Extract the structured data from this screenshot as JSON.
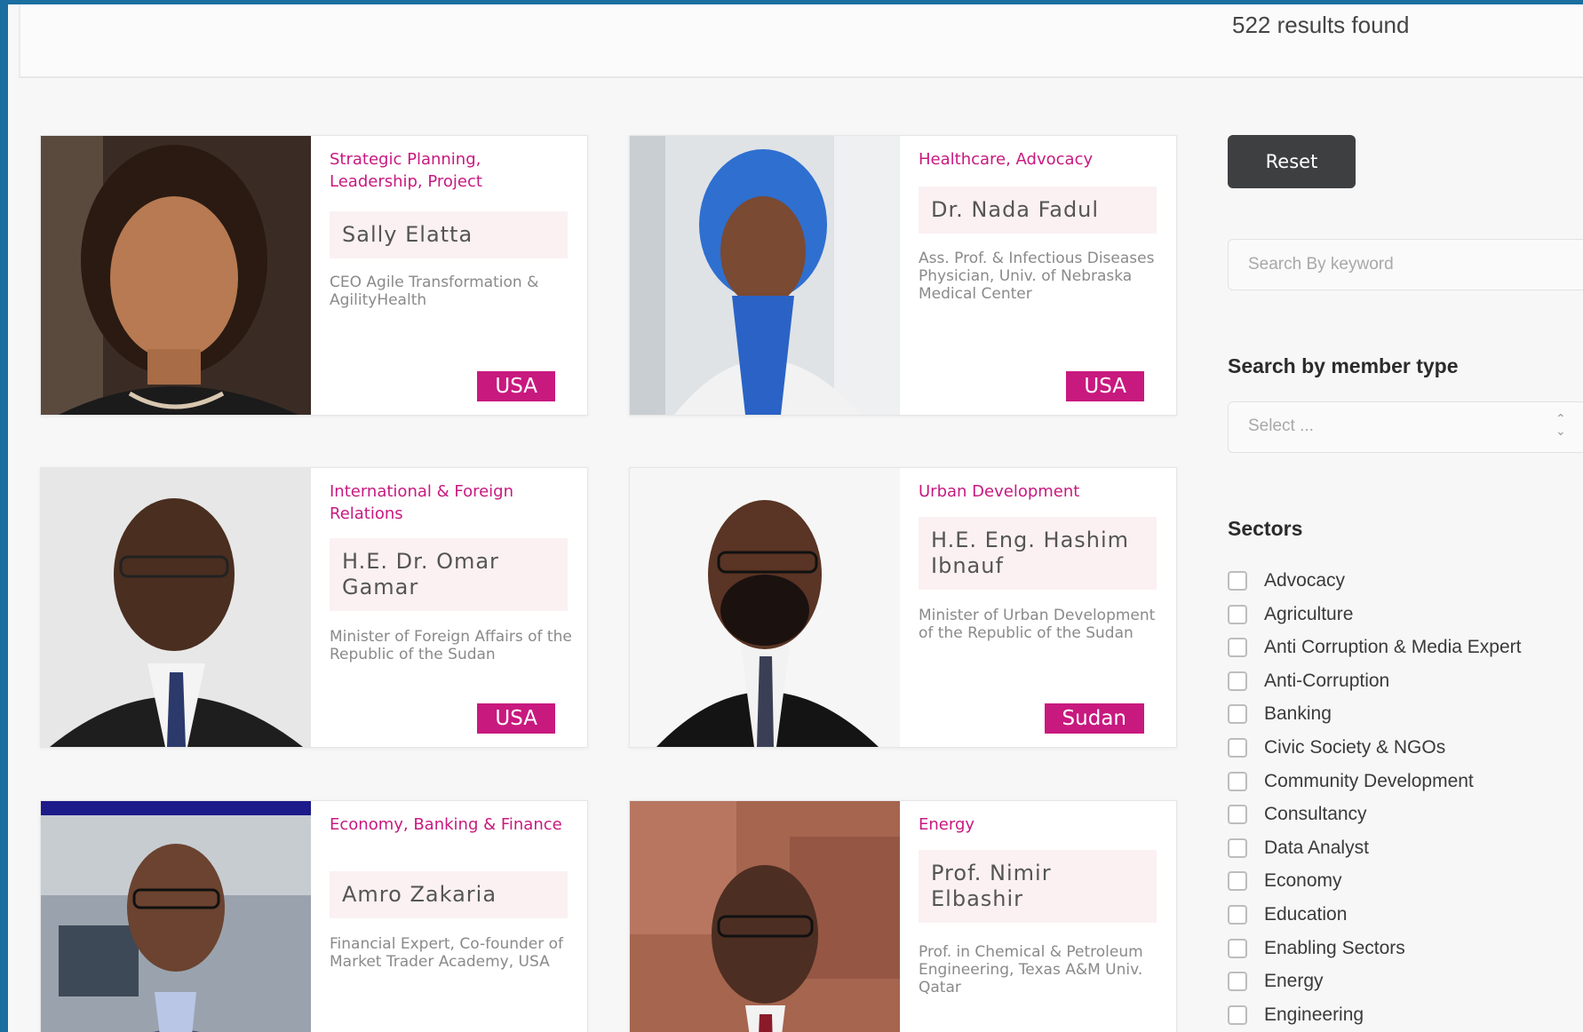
{
  "results": {
    "count_text": "522 results found"
  },
  "members": [
    {
      "sectors": "Strategic Planning, Leadership, Project",
      "name": "Sally Elatta",
      "role": "CEO Agile Transformation & AgilityHealth",
      "country": "USA"
    },
    {
      "sectors": "Healthcare, Advocacy",
      "name": "Dr. Nada Fadul",
      "role": "Ass. Prof. & Infectious Diseases Physician, Univ. of Nebraska Medical Center",
      "country": "USA"
    },
    {
      "sectors": "International & Foreign Relations",
      "name": "H.E. Dr. Omar Gamar",
      "role": "Minister of Foreign Affairs of the Republic of the Sudan",
      "country": "USA"
    },
    {
      "sectors": "Urban Development",
      "name": "H.E. Eng. Hashim Ibnauf",
      "role": "Minister of Urban Development of the Republic of the Sudan",
      "country": "Sudan"
    },
    {
      "sectors": "Economy, Banking & Finance",
      "name": "Amro Zakaria",
      "role": "Financial Expert, Co-founder of Market Trader Academy, USA",
      "country": ""
    },
    {
      "sectors": "Energy",
      "name": "Prof. Nimir Elbashir",
      "role": "Prof. in Chemical & Petroleum Engineering, Texas A&M Univ. Qatar",
      "country": ""
    }
  ],
  "sidebar": {
    "reset_label": "Reset",
    "search_placeholder": "Search By keyword",
    "member_type_heading": "Search by member type",
    "member_type_value": "Select ...",
    "sectors_heading": "Sectors",
    "sectors": [
      "Advocacy",
      "Agriculture",
      "Anti Corruption & Media Expert",
      "Anti-Corruption",
      "Banking",
      "Civic Society & NGOs",
      "Community Development",
      "Consultancy",
      "Data Analyst",
      "Economy",
      "Education",
      "Enabling Sectors",
      "Energy",
      "Engineering"
    ]
  },
  "colors": {
    "accent": "#c8197f",
    "button": "#3d3f41",
    "frame": "#1a6ea0"
  }
}
